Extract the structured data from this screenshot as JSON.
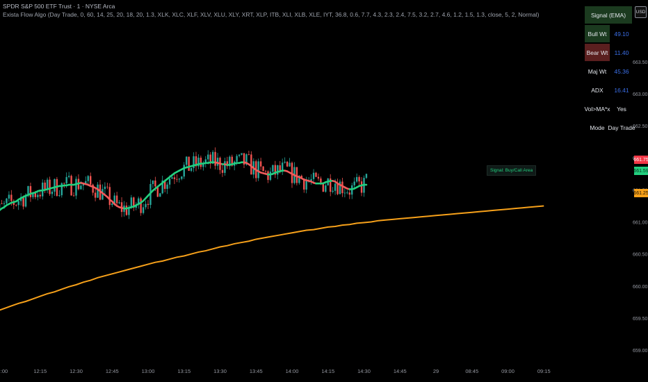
{
  "header": {
    "title": "SPDR S&P 500 ETF Trust · 1 · NYSE Arca",
    "indicator": "Exista Flow Algo (Day Trade, 0, 60, 14, 25, 20, 18, 20, 1.3, XLK, XLC, XLF, XLV, XLU, XLY, XRT, XLP, ITB, XLI, XLB, XLE, IYT, 36.8, 0.6, 7.7, 4.3, 2.3, 2.4, 7.5, 3.2, 2.7, 4.6, 1.2, 1.5, 1.3, close, 5, 2, Normal)"
  },
  "currency": "USD",
  "table": {
    "header": "Signal (EMA)",
    "rows": [
      {
        "label": "Bull Wt",
        "value": "49.10"
      },
      {
        "label": "Bear Wt",
        "value": "11.40"
      },
      {
        "label": "Maj Wt",
        "value": "45.36"
      },
      {
        "label": "ADX",
        "value": "16.41"
      },
      {
        "label": "Vol>MA*x",
        "value": "Yes"
      },
      {
        "label": "Mode",
        "value": "Day Trade"
      }
    ]
  },
  "signal_label": "Signal: Buy/Call Area",
  "price_tags": [
    {
      "text": "661.75",
      "color": "#f23645"
    },
    {
      "text": "661.59",
      "color": "#22d07f"
    },
    {
      "text": "661.25",
      "color": "#f7a11a"
    }
  ],
  "colors": {
    "bull": "#26a69a",
    "bear": "#ef5350",
    "ema_up": "#22d07f",
    "ema_down": "#f05a5a",
    "slow_ma": "#f7a11a",
    "table_bull_bg": "#1b3a1f",
    "table_bear_bg": "#5a1f1f"
  },
  "chart_data": {
    "type": "line",
    "title": "SPDR S&P 500 ETF Trust",
    "xlabel": "",
    "ylabel": "",
    "ylim": [
      658.85,
      664.05
    ],
    "y_ticks": [
      659.0,
      659.5,
      660.0,
      660.5,
      661.0,
      661.5,
      662.0,
      662.5,
      663.0,
      663.5
    ],
    "y_tick_labels": [
      "659.00",
      "659.50",
      "660.00",
      "660.50",
      "661.00",
      "661.50",
      "662.00",
      "662.50",
      "663.00",
      "663.50"
    ],
    "x_tick_labels": [
      ":00",
      "12:15",
      "12:30",
      "12:45",
      "13:00",
      "13:15",
      "13:30",
      "13:45",
      "14:00",
      "14:15",
      "14:30",
      "14:45",
      "29",
      "08:45",
      "09:00",
      "09:15"
    ],
    "x_tick_bars": [
      0,
      15,
      30,
      45,
      60,
      75,
      90,
      105,
      120,
      135,
      150,
      165,
      180,
      195,
      210,
      225
    ],
    "x_tick_bold": [
      12
    ],
    "bars_per_15min": 15,
    "series": [
      {
        "name": "EMA",
        "x_start_bar": -6,
        "values": [
          661.1,
          661.12,
          661.15,
          661.17,
          661.18,
          661.21,
          661.23,
          661.26,
          661.28,
          661.3,
          661.31,
          661.32,
          661.35,
          661.37,
          661.39,
          661.41,
          661.42,
          661.44,
          661.45,
          661.46,
          661.48,
          661.49,
          661.49,
          661.5,
          661.51,
          661.52,
          661.53,
          661.54,
          661.55,
          661.56,
          661.56,
          661.57,
          661.57,
          661.58,
          661.58,
          661.58,
          661.59,
          661.6,
          661.61,
          661.6,
          661.59,
          661.58,
          661.56,
          661.55,
          661.53,
          661.51,
          661.48,
          661.45,
          661.42,
          661.39,
          661.35,
          661.32,
          661.28,
          661.25,
          661.23,
          661.22,
          661.21,
          661.21,
          661.22,
          661.23,
          661.24,
          661.26,
          661.28,
          661.3,
          661.33,
          661.37,
          661.41,
          661.45,
          661.49,
          661.52,
          661.55,
          661.58,
          661.61,
          661.64,
          661.67,
          661.7,
          661.73,
          661.76,
          661.78,
          661.8,
          661.82,
          661.84,
          661.85,
          661.86,
          661.87,
          661.88,
          661.89,
          661.9,
          661.91,
          661.91,
          661.92,
          661.92,
          661.93,
          661.93,
          661.93,
          661.92,
          661.91,
          661.9,
          661.9,
          661.89,
          661.89,
          661.9,
          661.91,
          661.92,
          661.92,
          661.93,
          661.93,
          661.92,
          661.9,
          661.87,
          661.84,
          661.81,
          661.79,
          661.77,
          661.76,
          661.75,
          661.74,
          661.74,
          661.75,
          661.77,
          661.78,
          661.79,
          661.8,
          661.8,
          661.79,
          661.77,
          661.75,
          661.73,
          661.71,
          661.7,
          661.68,
          661.66,
          661.65,
          661.64,
          661.63,
          661.61,
          661.6,
          661.6,
          661.6,
          661.6,
          661.62,
          661.63,
          661.64,
          661.64,
          661.63,
          661.6,
          661.58,
          661.56,
          661.54,
          661.52,
          661.51,
          661.51,
          661.52,
          661.54,
          661.56,
          661.57,
          661.58,
          661.58
        ],
        "value_range": [
          661.1,
          661.93
        ]
      },
      {
        "name": "Slow MA",
        "x_start_bar": -6,
        "values": [
          659.58,
          659.61,
          659.65,
          659.69,
          659.73,
          659.76,
          659.8,
          659.84,
          659.88,
          659.91,
          659.95,
          659.99,
          660.02,
          660.06,
          660.09,
          660.13,
          660.16,
          660.19,
          660.22,
          660.25,
          660.28,
          660.31,
          660.34,
          660.37,
          660.39,
          660.42,
          660.45,
          660.47,
          660.5,
          660.53,
          660.55,
          660.58,
          660.61,
          660.63,
          660.66,
          660.68,
          660.7,
          660.73,
          660.75,
          660.77,
          660.79,
          660.81,
          660.83,
          660.85,
          660.87,
          660.88,
          660.9,
          660.92,
          660.93,
          660.95,
          660.96,
          660.98,
          660.99,
          661.0,
          661.02,
          661.03,
          661.04,
          661.05,
          661.06,
          661.07,
          661.08,
          661.09,
          661.1,
          661.11,
          661.12,
          661.13,
          661.14,
          661.15,
          661.16,
          661.17,
          661.18,
          661.19,
          661.2,
          661.21,
          661.22,
          661.23,
          661.24,
          661.25
        ],
        "value_range": [
          659.58,
          661.25
        ]
      }
    ],
    "candles": {
      "start_bar": -6,
      "description": "1-minute OHLC candles, close oscillates around EMA between 661.05 and 662.0",
      "close_range": [
        661.0,
        662.0
      ],
      "high_max": 662.05,
      "low_min": 660.93,
      "last_close": 661.75
    }
  }
}
